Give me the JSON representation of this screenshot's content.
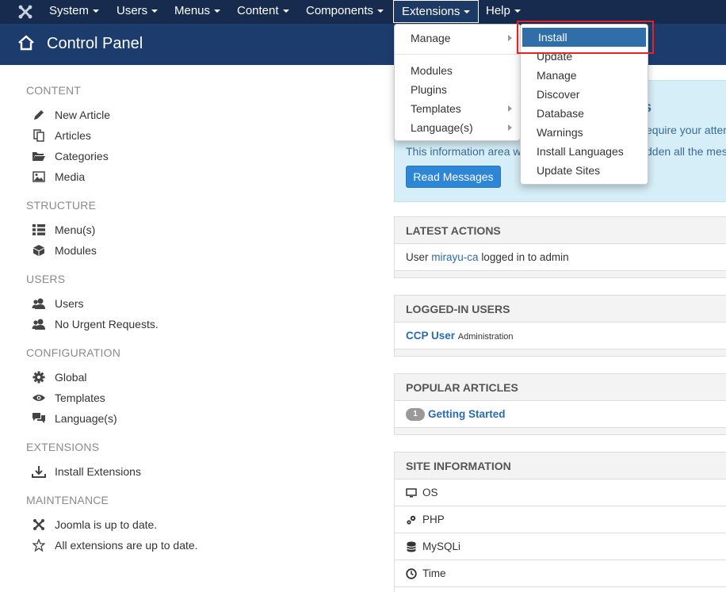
{
  "nav": {
    "items": [
      {
        "label": "System"
      },
      {
        "label": "Users"
      },
      {
        "label": "Menus"
      },
      {
        "label": "Content"
      },
      {
        "label": "Components"
      },
      {
        "label": "Extensions"
      },
      {
        "label": "Help"
      }
    ]
  },
  "header": {
    "title": "Control Panel"
  },
  "sidebar": {
    "content_title": "CONTENT",
    "content": [
      "New Article",
      "Articles",
      "Categories",
      "Media"
    ],
    "structure_title": "STRUCTURE",
    "structure": [
      "Menu(s)",
      "Modules"
    ],
    "users_title": "USERS",
    "users": [
      "Users",
      "No Urgent Requests."
    ],
    "config_title": "CONFIGURATION",
    "config": [
      "Global",
      "Templates",
      "Language(s)"
    ],
    "extensions_title": "EXTENSIONS",
    "extensions": [
      "Install Extensions"
    ],
    "maintenance_title": "MAINTENANCE",
    "maintenance": [
      "Joomla is up to date.",
      "All extensions are up to date."
    ]
  },
  "messages": {
    "heading_fragment": "s",
    "line1_fragment": "equire your attent",
    "line2": "This information area wor",
    "line2_fragment": "dden all the mess",
    "button": "Read Messages"
  },
  "latest_actions": {
    "title": "LATEST ACTIONS",
    "prefix": "User",
    "user": "mirayu-ca",
    "suffix": "logged in to admin"
  },
  "logged_in": {
    "title": "LOGGED-IN USERS",
    "user": "CCP User",
    "role": "Administration"
  },
  "popular": {
    "title": "POPULAR ARTICLES",
    "count": "1",
    "article": "Getting Started"
  },
  "site_info": {
    "title": "SITE INFORMATION",
    "rows": [
      "OS",
      "PHP",
      "MySQLi",
      "Time"
    ]
  },
  "ext_menu": {
    "items": [
      "Manage",
      "Modules",
      "Plugins",
      "Templates",
      "Language(s)"
    ]
  },
  "manage_menu": {
    "items": [
      "Install",
      "Update",
      "Manage",
      "Discover",
      "Database",
      "Warnings",
      "Install Languages",
      "Update Sites"
    ]
  },
  "colors": {
    "navbar": "#162b4d",
    "header": "#1d3c6e",
    "highlight": "#2f6ea8",
    "annotation": "#e0242a"
  }
}
